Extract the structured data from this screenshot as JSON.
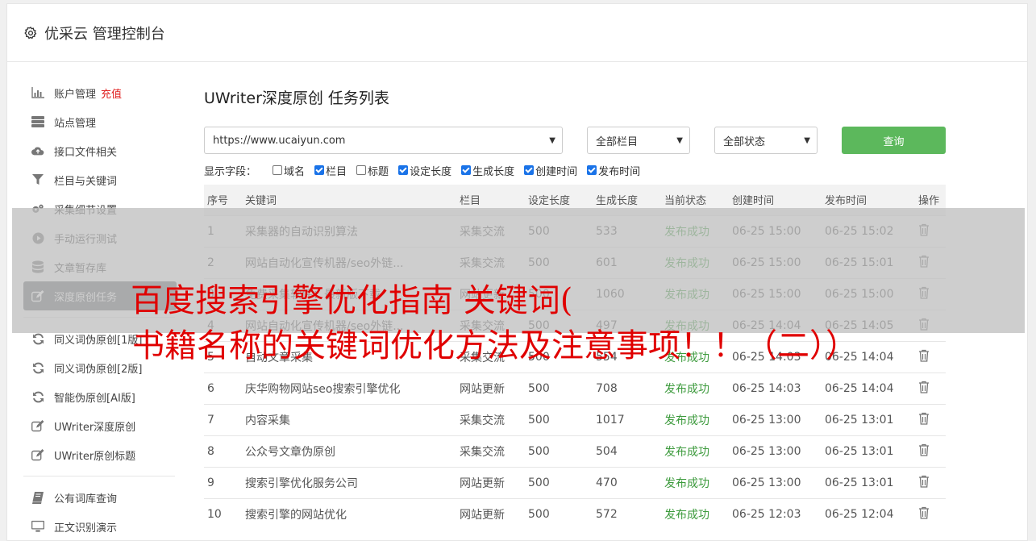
{
  "header": {
    "title": "优采云 管理控制台"
  },
  "sidebar": {
    "items": [
      {
        "label": "账户管理",
        "extra": "充值",
        "icon": "bar-chart-icon"
      },
      {
        "label": "站点管理",
        "icon": "server-icon"
      },
      {
        "label": "接口文件相关",
        "icon": "cloud-upload-icon"
      },
      {
        "label": "栏目与关键词",
        "icon": "filter-icon"
      },
      {
        "label": "采集细节设置",
        "icon": "cogs-icon"
      },
      {
        "label": "手动运行测试",
        "icon": "play-circle-icon"
      },
      {
        "label": "文章暂存库",
        "icon": "database-icon"
      },
      {
        "label": "深度原创任务",
        "icon": "edit-icon"
      },
      {
        "label": "同义词伪原创[1版]",
        "icon": "refresh-icon"
      },
      {
        "label": "同义词伪原创[2版]",
        "icon": "refresh-icon"
      },
      {
        "label": "智能伪原创[AI版]",
        "icon": "refresh-icon"
      },
      {
        "label": "UWriter深度原创",
        "icon": "edit-icon"
      },
      {
        "label": "UWriter原创标题",
        "icon": "edit-icon"
      },
      {
        "label": "公有词库查询",
        "icon": "book-icon"
      },
      {
        "label": "正文识别演示",
        "icon": "monitor-icon"
      }
    ]
  },
  "main": {
    "title": "UWriter深度原创 任务列表",
    "site_select": "https://www.ucaiyun.com",
    "column_select": "全部栏目",
    "status_select": "全部状态",
    "query_label": "查询",
    "fields_label": "显示字段：",
    "fields": [
      {
        "label": "域名",
        "checked": false
      },
      {
        "label": "栏目",
        "checked": true
      },
      {
        "label": "标题",
        "checked": false
      },
      {
        "label": "设定长度",
        "checked": true
      },
      {
        "label": "生成长度",
        "checked": true
      },
      {
        "label": "创建时间",
        "checked": true
      },
      {
        "label": "发布时间",
        "checked": true
      }
    ],
    "table": {
      "headers": [
        "序号",
        "关键词",
        "栏目",
        "设定长度",
        "生成长度",
        "当前状态",
        "创建时间",
        "发布时间",
        "操作"
      ],
      "rows": [
        [
          "1",
          "采集器的自动识别算法",
          "采集交流",
          "500",
          "533",
          "发布成功",
          "06-25 15:00",
          "06-25 15:02"
        ],
        [
          "2",
          "网站自动化宣传机器/seo外链...",
          "采集交流",
          "500",
          "601",
          "发布成功",
          "06-25 15:00",
          "06-25 15:01"
        ],
        [
          "3",
          "免费采集软件：最新版下载",
          "网站更新",
          "500",
          "1060",
          "发布成功",
          "06-25 15:00",
          "06-25 15:00"
        ],
        [
          "4",
          "网站自动化宣传机器/seo外链...",
          "采集交流",
          "500",
          "497",
          "发布成功",
          "06-25 14:04",
          "06-25 14:05"
        ],
        [
          "5",
          "自动文章采集",
          "采集交流",
          "500",
          "554",
          "发布成功",
          "06-25 14:03",
          "06-25 14:04"
        ],
        [
          "6",
          "庆华购物网站seo搜索引擎优化",
          "网站更新",
          "500",
          "708",
          "发布成功",
          "06-25 14:03",
          "06-25 14:04"
        ],
        [
          "7",
          "内容采集",
          "采集交流",
          "500",
          "1017",
          "发布成功",
          "06-25 13:00",
          "06-25 13:01"
        ],
        [
          "8",
          "公众号文章伪原创",
          "采集交流",
          "500",
          "504",
          "发布成功",
          "06-25 13:00",
          "06-25 13:01"
        ],
        [
          "9",
          "搜索引擎优化服务公司",
          "网站更新",
          "500",
          "470",
          "发布成功",
          "06-25 13:00",
          "06-25 13:01"
        ],
        [
          "10",
          "搜索引擎的网站优化",
          "网站更新",
          "500",
          "572",
          "发布成功",
          "06-25 12:03",
          "06-25 12:04"
        ]
      ]
    }
  },
  "overlay": {
    "line1": "百度搜索引擎优化指南 关键词(",
    "line2": "书籍名称的关键词优化方法及注意事项！！（二））"
  },
  "colors": {
    "accent_green": "#5cb85c",
    "status_green": "#3c9a3c",
    "overlay_red": "#e00000",
    "active_bg": "#6d7175"
  }
}
